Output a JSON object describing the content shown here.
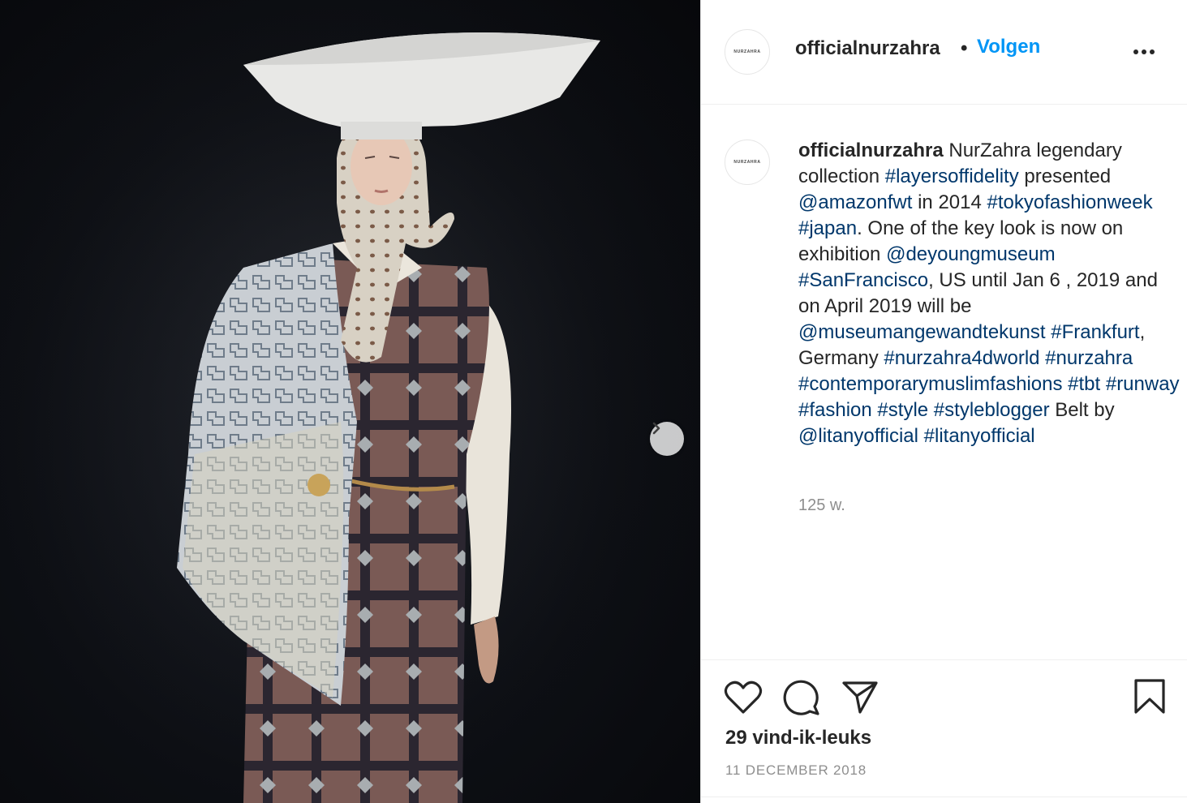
{
  "post": {
    "image_alt": "Runway look",
    "header": {
      "avatar_text": "NURZAHRA",
      "username": "officialnurzahra",
      "separator": "•",
      "follow_label": "Volgen",
      "more_icon": "more-dots-icon"
    },
    "caption": {
      "avatar_text": "NURZAHRA",
      "username": "officialnurzahra",
      "segments": [
        {
          "t": "text",
          "v": " NurZahra legendary collection "
        },
        {
          "t": "link",
          "v": "#layersoffidelity"
        },
        {
          "t": "text",
          "v": " presented "
        },
        {
          "t": "link",
          "v": "@amazonfwt"
        },
        {
          "t": "text",
          "v": " in 2014 "
        },
        {
          "t": "link",
          "v": "#tokyofashionweek"
        },
        {
          "t": "text",
          "v": " "
        },
        {
          "t": "link",
          "v": "#japan"
        },
        {
          "t": "text",
          "v": ". One of the key look is now on exhibition "
        },
        {
          "t": "link",
          "v": "@deyoungmuseum"
        },
        {
          "t": "text",
          "v": " "
        },
        {
          "t": "link",
          "v": "#SanFrancisco"
        },
        {
          "t": "text",
          "v": ", US until Jan 6 , 2019 and on April 2019 will be "
        },
        {
          "t": "link",
          "v": "@museumangewandtekunst"
        },
        {
          "t": "text",
          "v": " "
        },
        {
          "t": "link",
          "v": "#Frankfurt"
        },
        {
          "t": "text",
          "v": ", Germany "
        },
        {
          "t": "link",
          "v": "#nurzahra4dworld"
        },
        {
          "t": "text",
          "v": " "
        },
        {
          "t": "link",
          "v": "#nurzahra"
        },
        {
          "t": "text",
          "v": " "
        },
        {
          "t": "link",
          "v": "#contemporarymuslimfashions"
        },
        {
          "t": "text",
          "v": " "
        },
        {
          "t": "link",
          "v": "#tbt"
        },
        {
          "t": "text",
          "v": " "
        },
        {
          "t": "link",
          "v": "#runway"
        },
        {
          "t": "text",
          "v": " "
        },
        {
          "t": "link",
          "v": "#fashion"
        },
        {
          "t": "text",
          "v": " "
        },
        {
          "t": "link",
          "v": "#style"
        },
        {
          "t": "text",
          "v": " "
        },
        {
          "t": "link",
          "v": "#styleblogger"
        },
        {
          "t": "text",
          "v": " Belt by "
        },
        {
          "t": "link",
          "v": "@litanyofficial"
        },
        {
          "t": "text",
          "v": " "
        },
        {
          "t": "link",
          "v": "#litanyofficial"
        }
      ],
      "age": "125 w."
    },
    "actions": {
      "like_icon": "heart-icon",
      "comment_icon": "comment-icon",
      "share_icon": "share-icon",
      "save_icon": "bookmark-icon",
      "likes": "29 vind-ik-leuks",
      "date": "11 DECEMBER 2018"
    },
    "carousel": {
      "next_icon": "chevron-right-icon"
    },
    "colors": {
      "link": "#00376b",
      "follow": "#0095f6",
      "muted": "#8e8e8e",
      "text": "#262626"
    }
  }
}
